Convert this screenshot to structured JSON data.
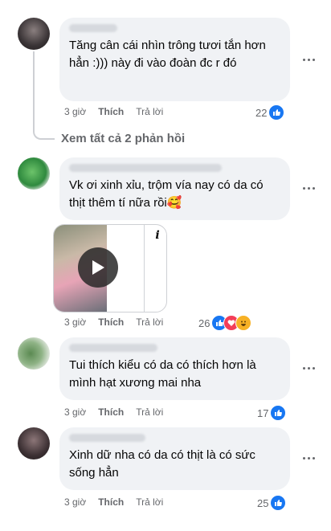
{
  "comments": [
    {
      "text": "Tăng cân cái nhìn trông tươi tắn hơn hẳn :))) này đi vào đoàn đc r đó",
      "time": "3 giờ",
      "like_label": "Thích",
      "reply_label": "Trả lời",
      "reactions": "22",
      "avatar_color": "#3a3436"
    },
    {
      "text": "Vk ơi xinh xỉu, trộm vía nay có da có thịt thêm tí nữa rồi🥰",
      "time": "3 giờ",
      "like_label": "Thích",
      "reply_label": "Trả lời",
      "reactions": "26",
      "avatar_color": "#2f8a3e",
      "image_overlay_icon": "i"
    },
    {
      "text": "Tui thích kiểu có da có thích hơn là mình hạt xương mai nha",
      "time": "3 giờ",
      "like_label": "Thích",
      "reply_label": "Trả lời",
      "reactions": "17",
      "avatar_color": "#5b8a52"
    },
    {
      "text": "Xinh dữ nha có da có thịt là có sức sống hẳn",
      "time": "3 giờ",
      "like_label": "Thích",
      "reply_label": "Trả lời",
      "reactions": "25",
      "avatar_color": "#3d3134"
    }
  ],
  "view_replies": "Xem tất cả 2 phản hồi",
  "colors": {
    "accent": "#1877f2",
    "bubble": "#f0f2f5",
    "muted": "#65676b"
  }
}
